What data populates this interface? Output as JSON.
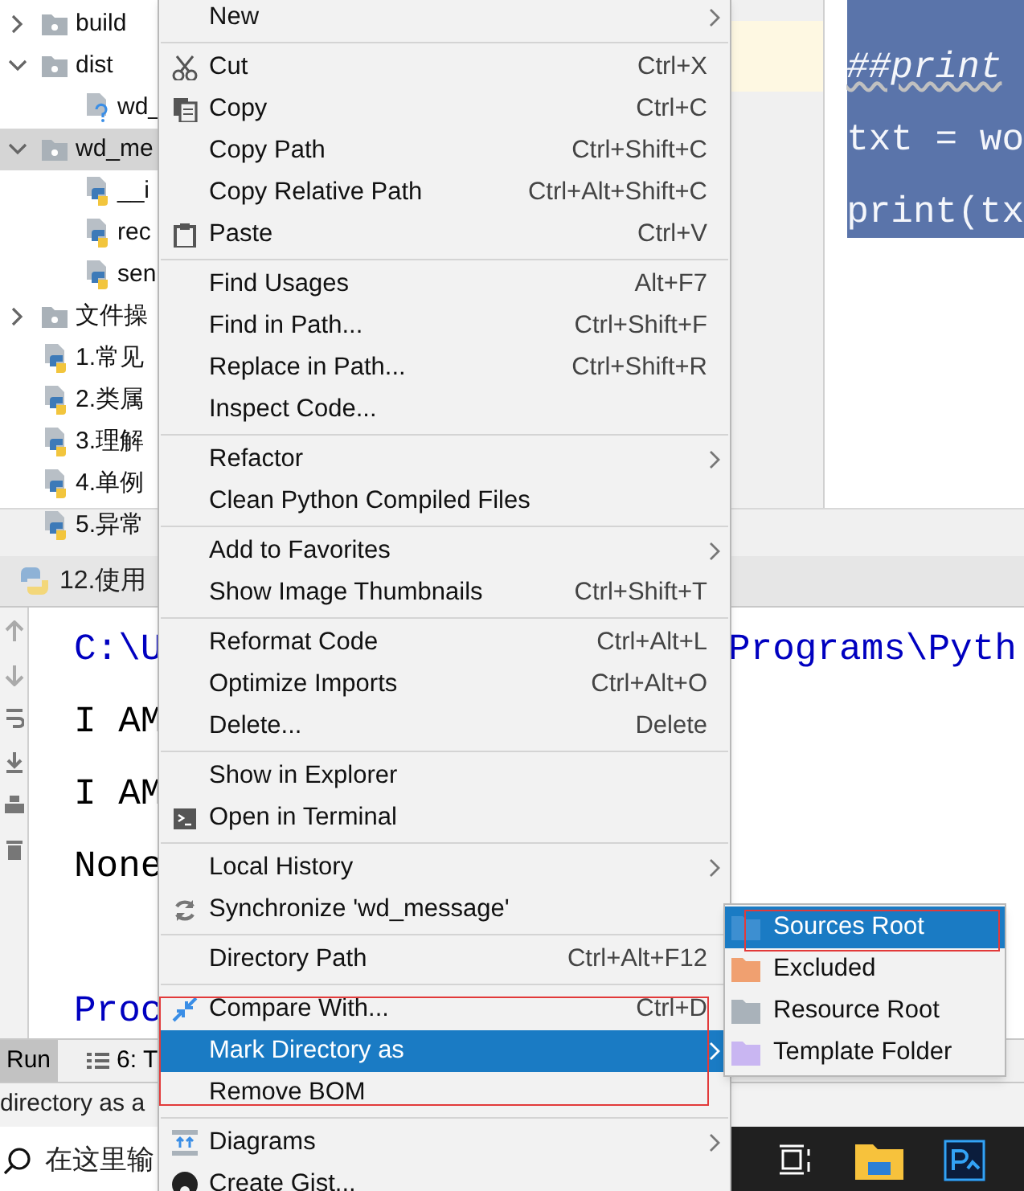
{
  "project_tree": [
    {
      "label": "build",
      "kind": "folder",
      "expanded": false,
      "selected": false
    },
    {
      "label": "dist",
      "kind": "folder",
      "expanded": true,
      "selected": false,
      "children": [
        {
          "label": "wd_",
          "kind": "unknown",
          "selected": false
        }
      ]
    },
    {
      "label": "wd_me",
      "kind": "folder",
      "expanded": true,
      "selected": true,
      "children": [
        {
          "label": "__i",
          "kind": "python",
          "selected": false
        },
        {
          "label": "rec",
          "kind": "python",
          "selected": false
        },
        {
          "label": "sen",
          "kind": "python",
          "selected": false
        }
      ]
    },
    {
      "label": "文件操",
      "kind": "folder",
      "expanded": false,
      "selected": false
    },
    {
      "label": "1.常见",
      "kind": "python",
      "selected": false
    },
    {
      "label": "2.类属",
      "kind": "python",
      "selected": false
    },
    {
      "label": "3.理解",
      "kind": "python",
      "selected": false
    },
    {
      "label": "4.单例",
      "kind": "python",
      "selected": false
    },
    {
      "label": "5.异常",
      "kind": "python",
      "selected": false
    }
  ],
  "editor": {
    "lines": [
      {
        "text": "##print",
        "kind": "comment"
      },
      {
        "text": "txt = wo",
        "kind": "code"
      },
      {
        "text": "print(tx",
        "kind": "code"
      }
    ]
  },
  "run_tab": {
    "label": "12.使用"
  },
  "console": {
    "lines": [
      {
        "text": "C:\\U",
        "tail": "Programs\\Pyth",
        "color": "#0000c0"
      },
      {
        "text": "I AM",
        "color": "#000000"
      },
      {
        "text": "I AM",
        "color": "#000000"
      },
      {
        "text": "None",
        "color": "#000000"
      },
      {
        "text": "Proc",
        "color": "#0000c0",
        "spaced": true
      }
    ]
  },
  "tool_tabs": [
    {
      "label": "Run",
      "selected": true
    },
    {
      "label": "6: T",
      "selected": false
    }
  ],
  "status_bar": {
    "text": "directory as a"
  },
  "taskbar": {
    "search_placeholder": "在这里输"
  },
  "context_menu": {
    "groups": [
      [
        {
          "label": "New",
          "submenu": true,
          "selected": false
        }
      ],
      [
        {
          "label": "Cut",
          "shortcut": "Ctrl+X",
          "selected": false
        },
        {
          "label": "Copy",
          "shortcut": "Ctrl+C",
          "selected": false
        },
        {
          "label": "Copy Path",
          "shortcut": "Ctrl+Shift+C",
          "selected": false
        },
        {
          "label": "Copy Relative Path",
          "shortcut": "Ctrl+Alt+Shift+C",
          "selected": false
        },
        {
          "label": "Paste",
          "shortcut": "Ctrl+V",
          "selected": false
        }
      ],
      [
        {
          "label": "Find Usages",
          "shortcut": "Alt+F7",
          "selected": false
        },
        {
          "label": "Find in Path...",
          "shortcut": "Ctrl+Shift+F",
          "selected": false
        },
        {
          "label": "Replace in Path...",
          "shortcut": "Ctrl+Shift+R",
          "selected": false
        },
        {
          "label": "Inspect Code...",
          "selected": false
        }
      ],
      [
        {
          "label": "Refactor",
          "submenu": true,
          "selected": false
        },
        {
          "label": "Clean Python Compiled Files",
          "selected": false
        }
      ],
      [
        {
          "label": "Add to Favorites",
          "submenu": true,
          "selected": false
        },
        {
          "label": "Show Image Thumbnails",
          "shortcut": "Ctrl+Shift+T",
          "selected": false
        }
      ],
      [
        {
          "label": "Reformat Code",
          "shortcut": "Ctrl+Alt+L",
          "selected": false
        },
        {
          "label": "Optimize Imports",
          "shortcut": "Ctrl+Alt+O",
          "selected": false
        },
        {
          "label": "Delete...",
          "shortcut": "Delete",
          "selected": false
        }
      ],
      [
        {
          "label": "Show in Explorer",
          "selected": false
        },
        {
          "label": "Open in Terminal",
          "selected": false
        }
      ],
      [
        {
          "label": "Local History",
          "submenu": true,
          "selected": false
        },
        {
          "label": "Synchronize 'wd_message'",
          "selected": false
        }
      ],
      [
        {
          "label": "Directory Path",
          "shortcut": "Ctrl+Alt+F12",
          "selected": false
        }
      ],
      [
        {
          "label": "Compare With...",
          "shortcut": "Ctrl+D",
          "selected": false
        },
        {
          "label": "Mark Directory as",
          "submenu": true,
          "selected": true,
          "framed": true
        },
        {
          "label": "Remove BOM",
          "selected": false
        }
      ],
      [
        {
          "label": "Diagrams",
          "submenu": true,
          "selected": false
        },
        {
          "label": "Create Gist...",
          "selected": false
        }
      ]
    ]
  },
  "submenu": {
    "items": [
      {
        "label": "Sources Root",
        "color": "#3d8fd1",
        "selected": true,
        "framed": true
      },
      {
        "label": "Excluded",
        "color": "#f0a070",
        "selected": false
      },
      {
        "label": "Resource Root",
        "color": "#a9b2ba",
        "selected": false
      },
      {
        "label": "Template Folder",
        "color": "#c9b6f2",
        "selected": false
      }
    ]
  }
}
